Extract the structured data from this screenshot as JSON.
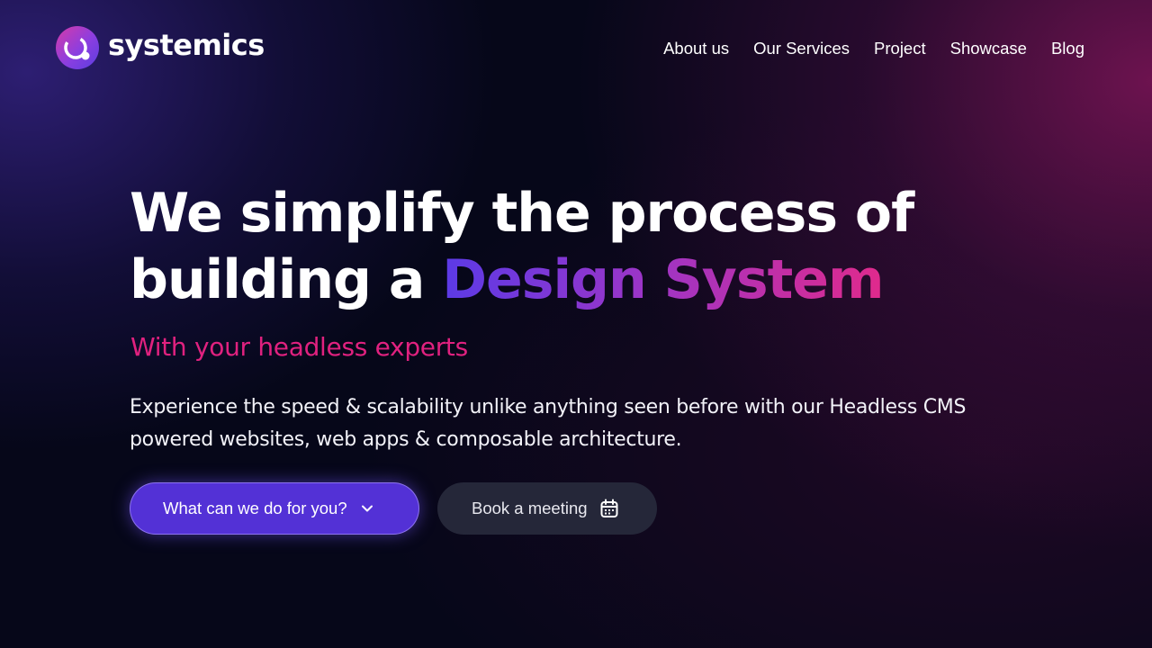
{
  "brand": {
    "name": "systemics",
    "logo_icon": "systemics-logo-icon"
  },
  "nav": {
    "items": [
      {
        "label": "About us"
      },
      {
        "label": "Our Services"
      },
      {
        "label": "Project"
      },
      {
        "label": "Showcase"
      },
      {
        "label": "Blog"
      }
    ]
  },
  "hero": {
    "headline_line1": "We simplify the process of",
    "headline_line2_prefix": "building a ",
    "headline_highlight": "Design System",
    "subheadline": "With your headless experts",
    "description": "Experience the speed & scalability unlike anything seen before with our Headless CMS powered websites, web apps & composable architecture.",
    "primary_button": {
      "label": "What can we do for you?",
      "icon": "chevron-down-icon"
    },
    "secondary_button": {
      "label": "Book a meeting",
      "icon": "calendar-icon"
    }
  },
  "colors": {
    "accent_purple": "#5331d6",
    "accent_pink": "#e0217f",
    "background": "#060719"
  }
}
